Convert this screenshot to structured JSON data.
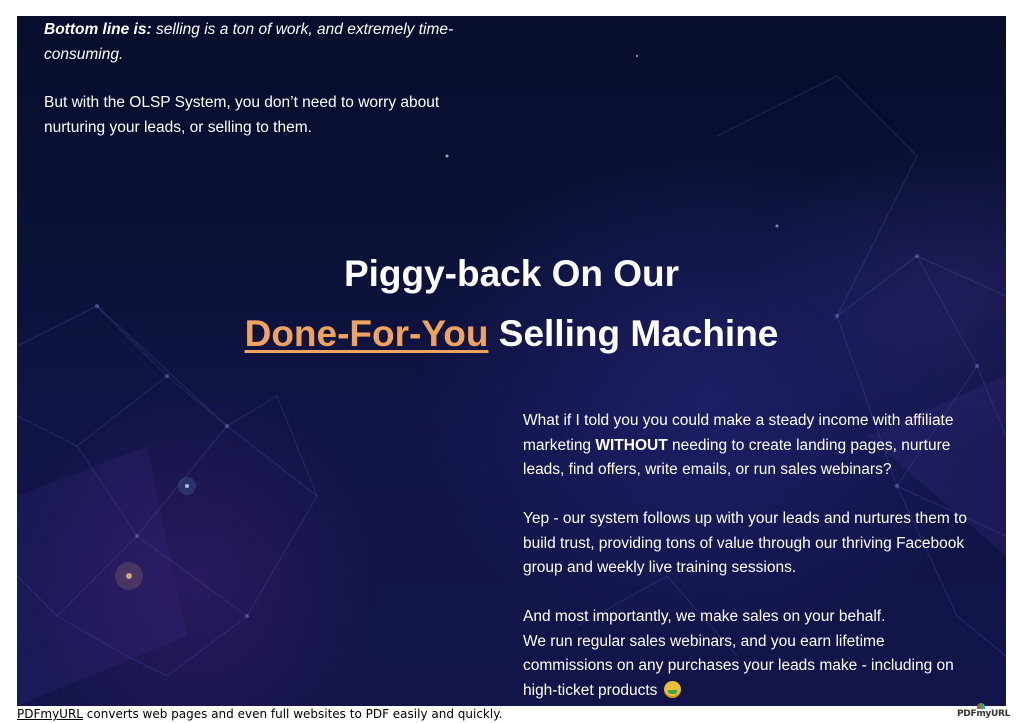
{
  "intro": {
    "bold_lead": "Bottom line is:",
    "italic_rest": " selling is a ton of work, and extremely time-consuming.",
    "paragraph_2": "But with the OLSP System, you don’t need to worry about nurturing your leads, or selling to them."
  },
  "headline": {
    "line_1": "Piggy-back On Our",
    "accent": "Done-For-You",
    "line_2_rest": " Selling Machine"
  },
  "body": {
    "p1_before": "What if I told you you could make a steady income with affiliate marketing ",
    "p1_bold": "WITHOUT",
    "p1_after": " needing to create landing pages, nurture leads, find offers, write emails, or run sales webinars?",
    "p2": "Yep - our system follows up with your leads and nurtures them to build trust, providing tons of value through our thriving Facebook group and weekly live training sessions.",
    "p3_line_1": "And most importantly, we make sales on your behalf.",
    "p3_line_2": "We run regular sales webinars, and you earn lifetime commissions on any purchases your leads make - including on high-ticket products",
    "emoji_icon": "money-mouth-face-icon"
  },
  "footer": {
    "link_text": "PDFmyURL",
    "rest_text": " converts web pages and even full websites to PDF easily and quickly.",
    "logo_text": "PDFmyURL"
  },
  "colors": {
    "accent": "#f0a35c",
    "background_dark": "#0b1238",
    "text": "#ffffff"
  }
}
